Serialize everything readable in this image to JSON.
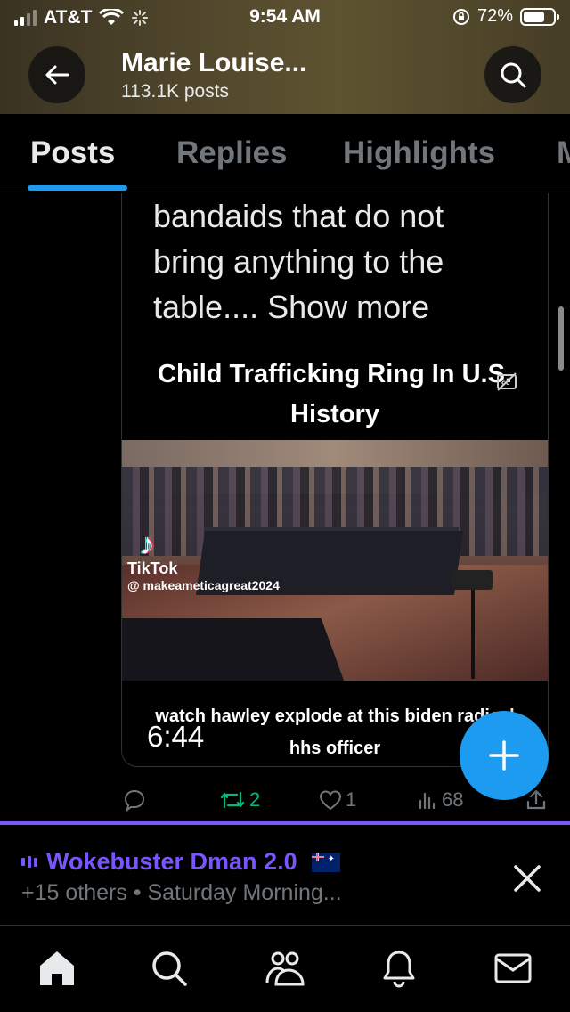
{
  "status_bar": {
    "carrier": "AT&T",
    "time": "9:54 AM",
    "battery": "72%",
    "battery_level": 0.72
  },
  "header": {
    "name": "Marie Louise...",
    "post_count": "113.1K posts",
    "back_icon": "arrow-left-icon",
    "search_icon": "search-icon"
  },
  "tabs": [
    {
      "label": "Posts",
      "active": true
    },
    {
      "label": "Replies",
      "active": false
    },
    {
      "label": "Highlights",
      "active": false
    },
    {
      "label": "M",
      "active": false
    }
  ],
  "tweet": {
    "text_lines": [
      "bandaids that do not",
      "bring anything to the",
      "table.... Show more"
    ],
    "video": {
      "headline_line1": "Child Trafficking Ring In U.S.",
      "headline_line2": "History",
      "tiktok_label": "TikTok",
      "tiktok_handle": "@ makeameticagreat2024",
      "caption_line1": "watch hawley explode at this biden radical",
      "caption_line2": "hhs officer",
      "duration": "6:44"
    },
    "actions": {
      "replies": "",
      "retweets": "2",
      "likes": "1",
      "views": "68"
    }
  },
  "space": {
    "title": "Wokebuster Dman 2.0",
    "subtitle": "+15 others • Saturday Morning..."
  },
  "bottom_nav": [
    {
      "name": "home",
      "icon": "home-icon"
    },
    {
      "name": "search",
      "icon": "search-icon"
    },
    {
      "name": "communities",
      "icon": "people-icon"
    },
    {
      "name": "notifications",
      "icon": "bell-icon"
    },
    {
      "name": "messages",
      "icon": "mail-icon"
    }
  ],
  "colors": {
    "accent": "#1d9bf0",
    "space_purple": "#7856ff",
    "retweet_green": "#00ba7c",
    "muted": "#71767b"
  }
}
